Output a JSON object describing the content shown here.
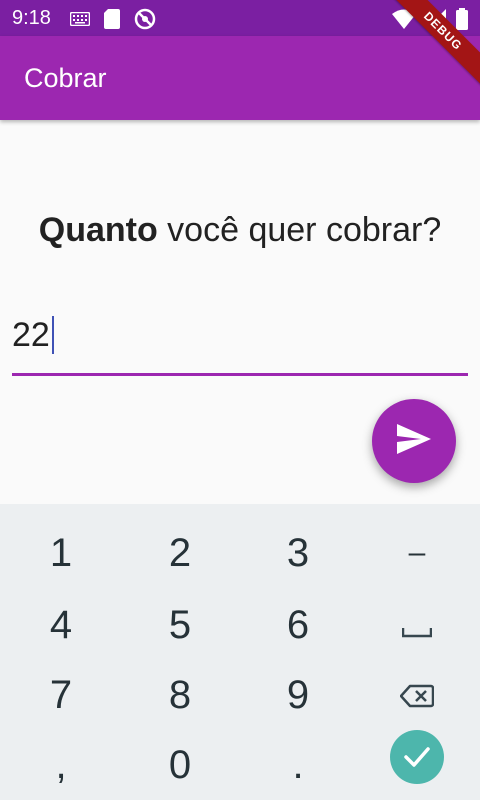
{
  "status_bar": {
    "time": "9:18",
    "icons_left": [
      "keyboard-icon",
      "sd-card-icon",
      "no-disturb-icon"
    ],
    "icons_right": [
      "wifi-icon",
      "signal-icon",
      "battery-icon"
    ]
  },
  "app_bar": {
    "title": "Cobrar"
  },
  "debug_banner": "DEBUG",
  "question": {
    "bold": "Quanto",
    "rest": " você quer cobrar?"
  },
  "amount_input": {
    "value": "22"
  },
  "fab": {
    "icon": "send-icon"
  },
  "keyboard": {
    "keys": [
      {
        "label": "1"
      },
      {
        "label": "2"
      },
      {
        "label": "3"
      },
      {
        "label": "–"
      },
      {
        "label": "4"
      },
      {
        "label": "5"
      },
      {
        "label": "6"
      },
      {
        "label": "␣"
      },
      {
        "label": "7"
      },
      {
        "label": "8"
      },
      {
        "label": "9"
      },
      {
        "label": "backspace-icon"
      },
      {
        "label": ","
      },
      {
        "label": "0"
      },
      {
        "label": "."
      },
      {
        "label": "check-icon"
      }
    ]
  },
  "colors": {
    "status_bar": "#7b1fa2",
    "primary": "#9c27b0",
    "keyboard_bg": "#eceff1",
    "ok_key": "#4db6ac",
    "debug": "#a31515"
  }
}
